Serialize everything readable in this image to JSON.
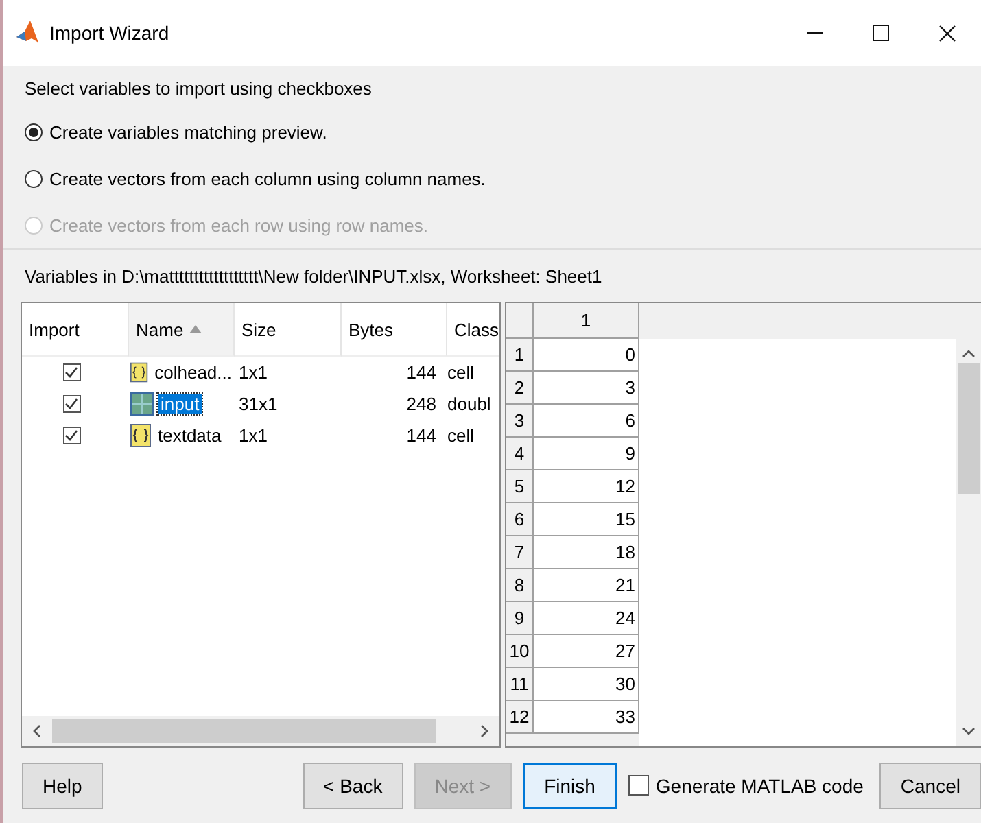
{
  "window": {
    "title": "Import Wizard"
  },
  "options": {
    "heading": "Select variables to import using checkboxes",
    "radios": [
      {
        "label": "Create variables matching preview.",
        "selected": true,
        "disabled": false
      },
      {
        "label": "Create vectors from each column using column names.",
        "selected": false,
        "disabled": false
      },
      {
        "label": "Create vectors from each row using row names.",
        "selected": false,
        "disabled": true
      }
    ]
  },
  "source_label": "Variables in D:\\matttttttttttttttttt\\New folder\\INPUT.xlsx, Worksheet: Sheet1",
  "variables": {
    "columns": [
      {
        "label": "Import",
        "sorted": false
      },
      {
        "label": "Name",
        "sorted": true
      },
      {
        "label": "Size",
        "sorted": false
      },
      {
        "label": "Bytes",
        "sorted": false
      },
      {
        "label": "Class",
        "sorted": false
      }
    ],
    "rows": [
      {
        "checked": true,
        "kind": "cell",
        "name": "colhead...",
        "size": "1x1",
        "bytes": "144",
        "class": "cell",
        "selected": false
      },
      {
        "checked": true,
        "kind": "matrix",
        "name": "input",
        "size": "31x1",
        "bytes": "248",
        "class": "doubl",
        "selected": true
      },
      {
        "checked": true,
        "kind": "cell",
        "name": "textdata",
        "size": "1x1",
        "bytes": "144",
        "class": "cell",
        "selected": false
      }
    ]
  },
  "preview": {
    "column_header": "1",
    "rows": [
      {
        "index": "1",
        "value": "0"
      },
      {
        "index": "2",
        "value": "3"
      },
      {
        "index": "3",
        "value": "6"
      },
      {
        "index": "4",
        "value": "9"
      },
      {
        "index": "5",
        "value": "12"
      },
      {
        "index": "6",
        "value": "15"
      },
      {
        "index": "7",
        "value": "18"
      },
      {
        "index": "8",
        "value": "21"
      },
      {
        "index": "9",
        "value": "24"
      },
      {
        "index": "10",
        "value": "27"
      },
      {
        "index": "11",
        "value": "30"
      },
      {
        "index": "12",
        "value": "33"
      }
    ]
  },
  "buttons": [
    {
      "label": "Help",
      "kind": "plain",
      "disabled": false
    },
    {
      "label": "< Back",
      "kind": "plain",
      "disabled": false
    },
    {
      "label": "Next >",
      "kind": "plain",
      "disabled": true
    },
    {
      "label": "Finish",
      "kind": "default",
      "disabled": false
    },
    {
      "label": "Generate MATLAB code",
      "kind": "checkbox",
      "checked": false
    },
    {
      "label": "Cancel",
      "kind": "plain",
      "disabled": false
    }
  ]
}
